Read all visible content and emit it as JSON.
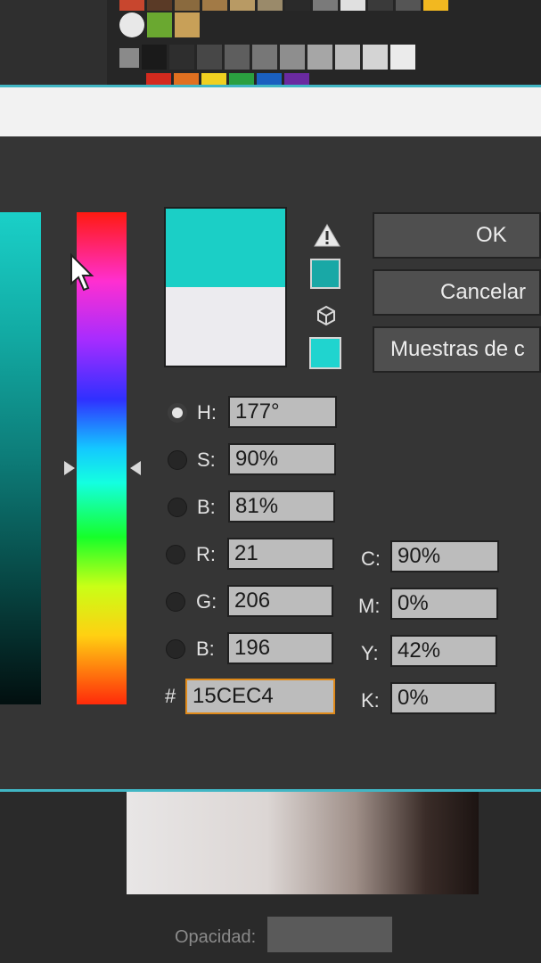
{
  "background_swatches": {
    "row1": [
      "#c8462e",
      "#5a3a26",
      "#8a6a3e",
      "#a27a46",
      "#b89a64",
      "#9a8a6a",
      "#2a2a2a",
      "#e0e0e0",
      "#f2b820"
    ],
    "row2": [
      "#e6c060",
      "#c8a058"
    ],
    "row3": [
      "#1a1a1a",
      "#2e2e2e",
      "#474747",
      "#5e5e5e",
      "#777777",
      "#8e8e8e",
      "#a6a6a6",
      "#bdbdbd",
      "#d4d4d4",
      "#ebebeb"
    ],
    "row4": [
      "#d42a1e",
      "#e07020",
      "#f0d020",
      "#2aa040",
      "#1a60c0",
      "#6a2aa0"
    ]
  },
  "background_bottom": {
    "opacity_label": "Opacidad:"
  },
  "preview": {
    "new_color": "#1bcfc6",
    "old_color": "#ecebef"
  },
  "buttons": {
    "ok": "OK",
    "cancel": "Cancelar",
    "swatches": "Muestras de c"
  },
  "hsb": [
    {
      "label": "H:",
      "value": "177°",
      "checked": true
    },
    {
      "label": "S:",
      "value": "90%",
      "checked": false
    },
    {
      "label": "B:",
      "value": "81%",
      "checked": false
    }
  ],
  "rgb": [
    {
      "label": "R:",
      "value": "21"
    },
    {
      "label": "G:",
      "value": "206"
    },
    {
      "label": "B:",
      "value": "196"
    }
  ],
  "hex": {
    "label": "#",
    "value": "15CEC4"
  },
  "cmyk": [
    {
      "label": "C:",
      "value": "90%"
    },
    {
      "label": "M:",
      "value": "0%"
    },
    {
      "label": "Y:",
      "value": "42%"
    },
    {
      "label": "K:",
      "value": "0%"
    }
  ],
  "icons": {
    "gamut_warning": "warning-triangle-icon",
    "websafe": "cube-icon",
    "cursor": "mouse-pointer-icon"
  },
  "accent_color": "#41b6c4"
}
